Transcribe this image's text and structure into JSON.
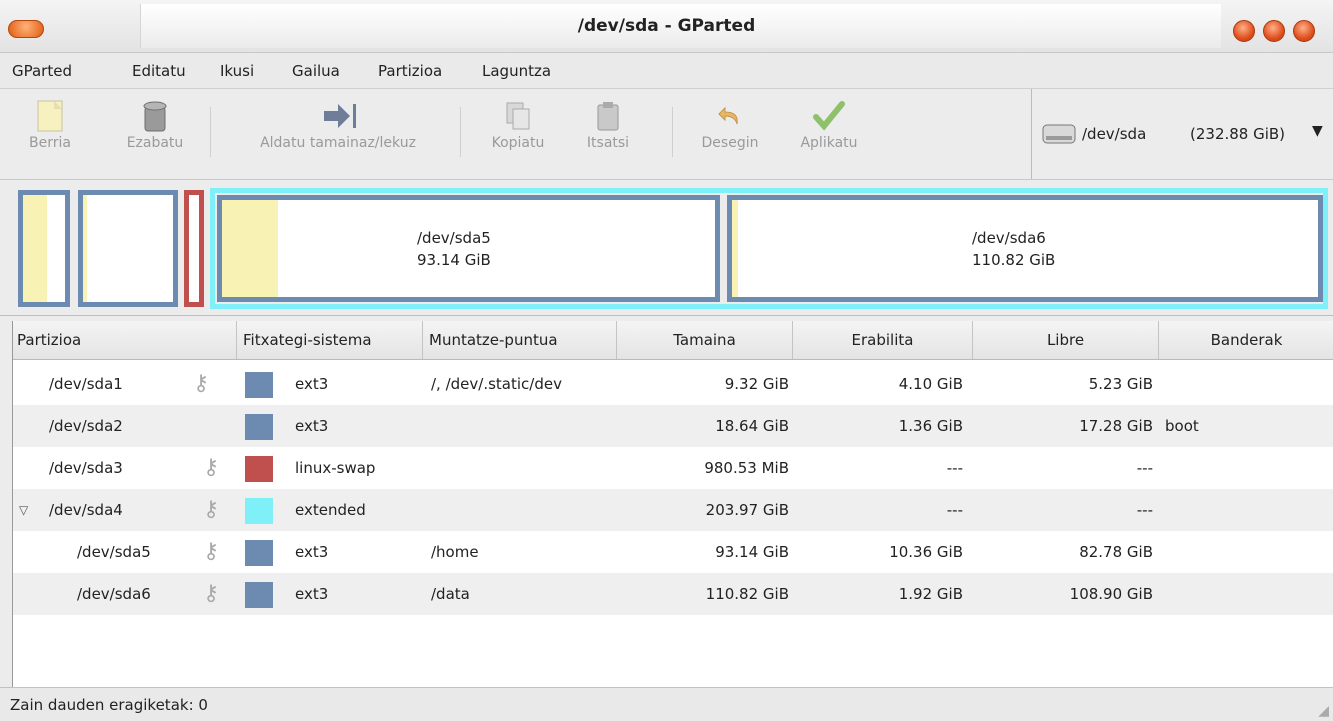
{
  "window": {
    "title": "/dev/sda - GParted"
  },
  "menu": [
    "GParted",
    "Editatu",
    "Ikusi",
    "Gailua",
    "Partizioa",
    "Laguntza"
  ],
  "toolbar": {
    "new": "Berria",
    "delete": "Ezabatu",
    "resize": "Aldatu tamainaz/lekuz",
    "copy": "Kopiatu",
    "paste": "Itsatsi",
    "undo": "Desegin",
    "apply": "Aplikatu"
  },
  "device": {
    "name": "/dev/sda",
    "size": "(232.88 GiB)"
  },
  "graph": {
    "sda5": {
      "name": "/dev/sda5",
      "size": "93.14 GiB"
    },
    "sda6": {
      "name": "/dev/sda6",
      "size": "110.82 GiB"
    }
  },
  "columns": [
    "Partizioa",
    "Fitxategi-sistema",
    "Muntatze-puntua",
    "Tamaina",
    "Erabilita",
    "Libre",
    "Banderak"
  ],
  "rows": [
    {
      "partition": "/dev/sda1",
      "fs": "ext3",
      "mount": "/, /dev/.static/dev",
      "size": "9.32 GiB",
      "used": "4.10 GiB",
      "free": "5.23 GiB",
      "flags": "",
      "color": "#6d8ab0"
    },
    {
      "partition": "/dev/sda2",
      "fs": "ext3",
      "mount": "",
      "size": "18.64 GiB",
      "used": "1.36 GiB",
      "free": "17.28 GiB",
      "flags": "boot",
      "color": "#6d8ab0"
    },
    {
      "partition": "/dev/sda3",
      "fs": "linux-swap",
      "mount": "",
      "size": "980.53 MiB",
      "used": "---",
      "free": "---",
      "flags": "",
      "color": "#c0504d"
    },
    {
      "partition": "/dev/sda4",
      "fs": "extended",
      "mount": "",
      "size": "203.97 GiB",
      "used": "---",
      "free": "---",
      "flags": "",
      "color": "#7ff0f8"
    },
    {
      "partition": "/dev/sda5",
      "fs": "ext3",
      "mount": "/home",
      "size": "93.14 GiB",
      "used": "10.36 GiB",
      "free": "82.78 GiB",
      "flags": "",
      "color": "#6d8ab0"
    },
    {
      "partition": "/dev/sda6",
      "fs": "ext3",
      "mount": "/data",
      "size": "110.82 GiB",
      "used": "1.92 GiB",
      "free": "108.90 GiB",
      "flags": "",
      "color": "#6d8ab0"
    }
  ],
  "status": {
    "text": "Zain dauden eragiketak: 0"
  }
}
